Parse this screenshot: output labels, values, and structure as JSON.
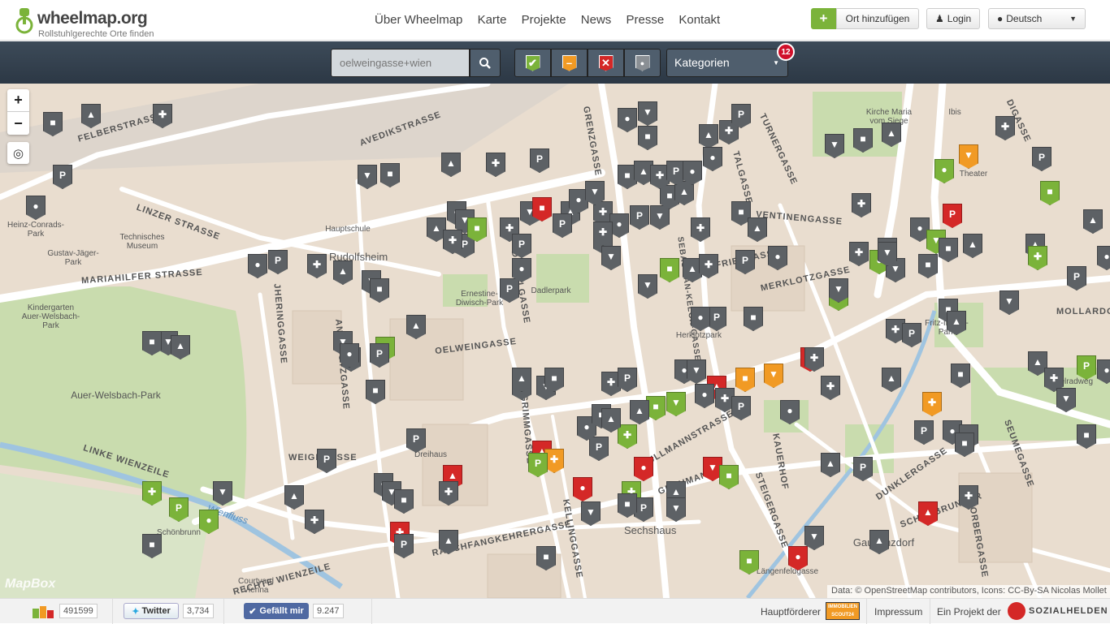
{
  "header": {
    "title": "wheelmap.org",
    "subtitle": "Rollstuhlgerechte Orte finden",
    "nav": [
      "Über Wheelmap",
      "Karte",
      "Projekte",
      "News",
      "Presse",
      "Kontakt"
    ],
    "add_place_label": "Ort hinzufügen",
    "login_label": "Login",
    "language_label": "Deutsch"
  },
  "toolbar": {
    "search_value": "oelweingasse+wien",
    "filters": [
      {
        "name": "yes",
        "symbol": "✔",
        "color": "#7bb33a"
      },
      {
        "name": "limited",
        "symbol": "–",
        "color": "#f19a24"
      },
      {
        "name": "no",
        "symbol": "✕",
        "color": "#d42827"
      },
      {
        "name": "unknown",
        "symbol": "●",
        "color": "#8a8f94"
      }
    ],
    "categories_label": "Kategorien",
    "categories_count": "12"
  },
  "map": {
    "streets": [
      "FELBERSTRASSE",
      "AVEDIKSTRASSE",
      "LINZER STRASSE",
      "MARIAHILFER STRASSE",
      "OELWEINGASSE",
      "LINKE WIENZEILE",
      "JHERINGGASSE",
      "ANSCHÜTZGASSE",
      "GRIMMGASSE",
      "DINGELGASSE",
      "SEBASTIAN-KELCH-GASSE",
      "MOLLARDG",
      "MERKLOTZGASSE",
      "FRIESGASSE",
      "STEIGERGASSE",
      "ULLMANNSTRASSE",
      "RAUCHFANGKEHRERGASSE",
      "DUNKLERGASSE",
      "SCHÖNBRUNNER",
      "KORBERGASSE",
      "GRENZGASSE",
      "TURNERGASSE",
      "DIGASSE",
      "VENTINENGASSE",
      "WEIGLGASSE",
      "RECHTE WIENZEILE",
      "KELLINGGASSE",
      "SEUMEGASSE",
      "TALGASSE",
      "KAUERHOF",
      "GRAUMANN"
    ],
    "places": [
      "Heinz-Conrads-Park",
      "Technisches Museum",
      "Gustav-Jäger-Park",
      "Kindergarten Auer-Welsbach-Park",
      "Auer-Welsbach-Park",
      "Ernestine-Diwisch-Park",
      "Dadlerpark",
      "Herklotzpark",
      "Fritz-Imhoff-Park",
      "Schönbrunn",
      "Courtyard Vienna",
      "Dreihaus",
      "Sechshaus",
      "Gaudenzdorf",
      "Kirche Maria vom Siege",
      "Ibis",
      "Theater",
      "Hauptschule",
      "Wienfluss",
      "Rudolfsheim",
      "Gürtelradweg",
      "Längenfeldgasse"
    ],
    "attribution": "Data: © OpenStreetMap contributors, Icons: CC-By-SA Nicolas Mollet",
    "watermark": "MapBox",
    "zoom_in": "+",
    "zoom_out": "−",
    "locate": "◎"
  },
  "footer": {
    "places_count": "491599",
    "twitter_label": "Twitter",
    "twitter_count": "3,734",
    "facebook_label": "Gefällt mir",
    "facebook_count": "9.247",
    "sponsor_label": "Hauptförderer",
    "imprint_label": "Impressum",
    "project_label": "Ein Projekt der",
    "org_name": "SOZIALHELDEN"
  }
}
